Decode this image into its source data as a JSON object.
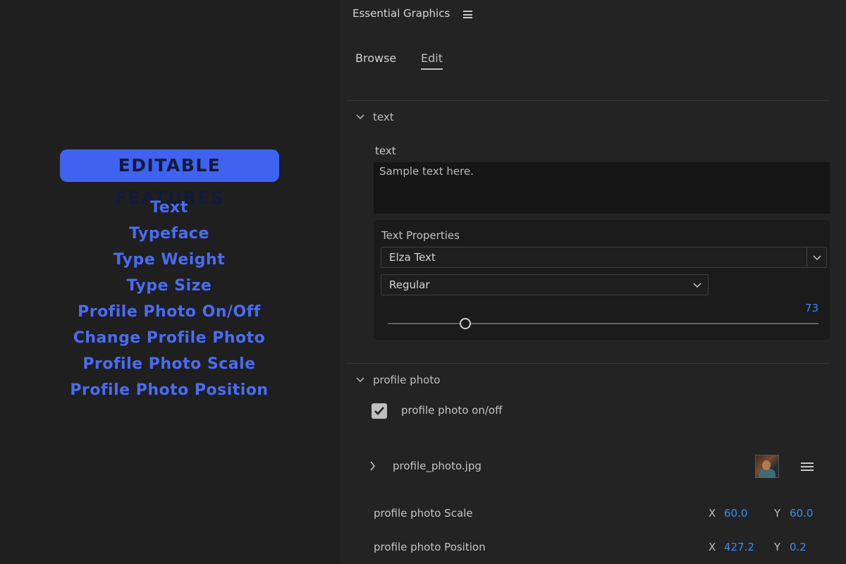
{
  "promo": {
    "badge": "EDITABLE FEATURES",
    "features": [
      "Text",
      "Typeface",
      "Type Weight",
      "Type Size",
      "Profile Photo On/Off",
      "Change Profile Photo",
      "Profile Photo Scale",
      "Profile Photo Position"
    ],
    "colors": {
      "badge_bg": "#3f63f0",
      "feature_text": "#4a6cf2"
    }
  },
  "panel": {
    "title": "Essential Graphics",
    "menu_icon": "hamburger-menu-icon",
    "tabs": [
      {
        "label": "Browse",
        "active": false
      },
      {
        "label": "Edit",
        "active": true
      }
    ]
  },
  "text_section": {
    "label": "text",
    "field_label": "text",
    "field_value": "Sample text here.",
    "properties_label": "Text Properties",
    "font": "Elza Text",
    "weight": "Regular",
    "size": "73",
    "size_fraction": 0.18
  },
  "profile_section": {
    "label": "profile photo",
    "toggle_label": "profile photo on/off",
    "toggle_checked": true,
    "file_name": "profile_photo.jpg",
    "scale": {
      "label": "profile photo Scale",
      "x_label": "X",
      "x": "60.0",
      "y_label": "Y",
      "y": "60.0"
    },
    "position": {
      "label": "profile photo Position",
      "x_label": "X",
      "x": "427.2",
      "y_label": "Y",
      "y": "0.2"
    }
  },
  "colors": {
    "accent_value": "#3a8dee",
    "panel_bg": "#232323"
  }
}
